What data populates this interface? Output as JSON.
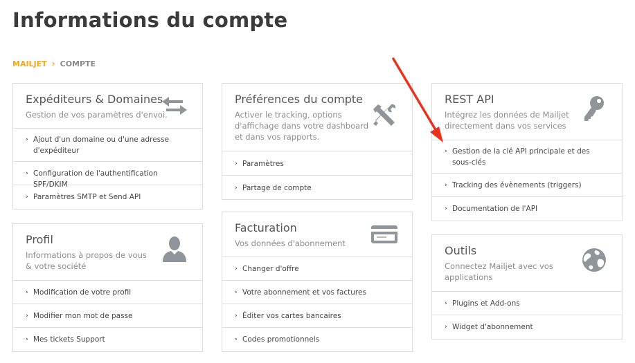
{
  "page": {
    "title": "Informations du compte"
  },
  "breadcrumb": {
    "home": "MAILJET",
    "separator": "›",
    "current": "COMPTE"
  },
  "chevron": "›",
  "cards": {
    "senders": {
      "title": "Expéditeurs & Domaines",
      "description": "Gestion de vos paramètres d'envoi.",
      "icon": "arrows-swap-icon",
      "links": [
        "Ajout d'un domaine ou d'une adresse d'expéditeur",
        "Configuration de l'authentification SPF/DKIM",
        "Paramètres SMTP et Send API"
      ]
    },
    "profile": {
      "title": "Profil",
      "description": "Informations à propos de vous & votre société",
      "icon": "user-icon",
      "links": [
        "Modification de votre profil",
        "Modifier mon mot de passe",
        "Mes tickets Support"
      ]
    },
    "preferences": {
      "title": "Préférences du compte",
      "description": "Activer le tracking, options d'affichage dans votre dashboard et dans vos rapports.",
      "icon": "tools-icon",
      "links": [
        "Paramètres",
        "Partage de compte"
      ]
    },
    "billing": {
      "title": "Facturation",
      "description": "Vos données d'abonnement",
      "icon": "credit-card-icon",
      "links": [
        "Changer d'offre",
        "Votre abonnement et vos factures",
        "Éditer vos cartes bancaires",
        "Codes promotionnels"
      ]
    },
    "restapi": {
      "title": "REST API",
      "description": "Intégrez les données de Mailjet directement dans vos services",
      "icon": "key-icon",
      "links": [
        "Gestion de la clé API principale et des sous-clés",
        "Tracking des évènements (triggers)",
        "Documentation de l'API"
      ]
    },
    "tools": {
      "title": "Outils",
      "description": "Connectez Mailjet avec vos applications",
      "icon": "globe-icon",
      "links": [
        "Plugins et Add-ons",
        "Widget d'abonnement"
      ]
    }
  },
  "colors": {
    "accent": "#f3a91c",
    "arrow": "#e8321f",
    "icon": "#8f9598",
    "border": "#dcdcdc"
  }
}
